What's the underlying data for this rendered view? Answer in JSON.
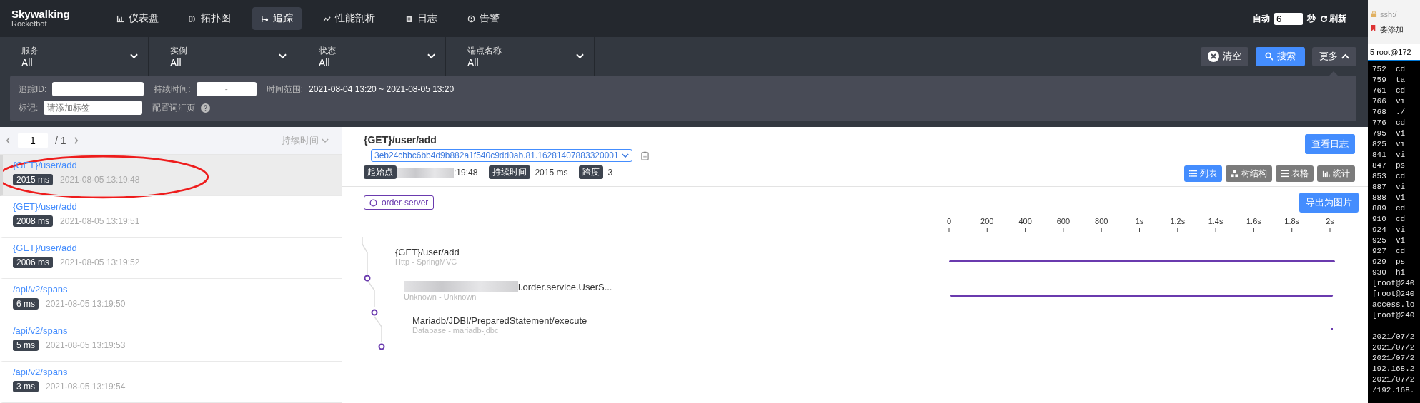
{
  "brand": {
    "name": "Skywalking",
    "sub": "Rocketbot"
  },
  "nav": [
    {
      "label": "仪表盘",
      "selected": false
    },
    {
      "label": "拓扑图",
      "selected": false
    },
    {
      "label": "追踪",
      "selected": true
    },
    {
      "label": "性能剖析",
      "selected": false
    },
    {
      "label": "日志",
      "selected": false
    },
    {
      "label": "告警",
      "selected": false
    }
  ],
  "refresh": {
    "auto_label": "自动",
    "interval": "6",
    "unit": "秒",
    "button": "刷新"
  },
  "filters": [
    {
      "label": "服务",
      "value": "All"
    },
    {
      "label": "实例",
      "value": "All"
    },
    {
      "label": "状态",
      "value": "All"
    },
    {
      "label": "端点名称",
      "value": "All"
    }
  ],
  "actions": {
    "clear": "清空",
    "search": "搜索",
    "more": "更多",
    "more_expanded": true
  },
  "advanced": {
    "trace_id_label": "追踪ID:",
    "duration_label": "持续时间:",
    "duration_sep": "-",
    "time_range_label": "时间范围:",
    "time_range": "2021-08-04 13:20 ~ 2021-08-05 13:20",
    "tags_label": "标记:",
    "tags_placeholder": "请添加标签",
    "vocab_link": "配置词汇页"
  },
  "pager": {
    "page": "1",
    "total": "/ 1",
    "sort": "持续时间"
  },
  "traces": [
    {
      "endpoint": "{GET}/user/add",
      "duration": "2015 ms",
      "time": "2021-08-05 13:19:48",
      "selected": true
    },
    {
      "endpoint": "{GET}/user/add",
      "duration": "2008 ms",
      "time": "2021-08-05 13:19:51",
      "selected": false
    },
    {
      "endpoint": "{GET}/user/add",
      "duration": "2006 ms",
      "time": "2021-08-05 13:19:52",
      "selected": false
    },
    {
      "endpoint": "/api/v2/spans",
      "duration": "6 ms",
      "time": "2021-08-05 13:19:50",
      "selected": false
    },
    {
      "endpoint": "/api/v2/spans",
      "duration": "5 ms",
      "time": "2021-08-05 13:19:53",
      "selected": false
    },
    {
      "endpoint": "/api/v2/spans",
      "duration": "3 ms",
      "time": "2021-08-05 13:19:54",
      "selected": false
    }
  ],
  "detail": {
    "title": "{GET}/user/add",
    "trace_id": "3eb24cbbc6bb4d9b882a1f540c9dd0ab.81.16281407883320001",
    "logs_button": "查看日志",
    "start_label": "起始点",
    "start_value": ":19:48",
    "duration_label": "持续时间",
    "duration_value": "2015 ms",
    "spans_label": "跨度",
    "spans_value": "3",
    "views": [
      {
        "label": "列表",
        "selected": true
      },
      {
        "label": "树结构",
        "selected": false
      },
      {
        "label": "表格",
        "selected": false
      },
      {
        "label": "统计",
        "selected": false
      }
    ],
    "service": "order-server",
    "export_button": "导出为图片",
    "spans": [
      {
        "name": "{GET}/user/add",
        "sub": "Http - SpringMVC",
        "blurred": false
      },
      {
        "name": "l.order.service.UserS...",
        "sub": "Unknown - Unknown",
        "blurred": true
      },
      {
        "name": "Mariadb/JDBI/PreparedStatement/execute",
        "sub": "Database - mariadb-jdbc",
        "blurred": false
      }
    ],
    "timeline_ticks": [
      "0",
      "200",
      "400",
      "600",
      "800",
      "1s",
      "1.2s",
      "1.4s",
      "1.6s",
      "1.8s",
      "2s"
    ]
  },
  "side_window": {
    "address": "ssh:/",
    "bookmark": "要添加",
    "tab": "5 root@172",
    "history": [
      "752  cd",
      "759  ta",
      "761  cd",
      "766  vi",
      "768  ./",
      "776  cd",
      "795  vi",
      "825  vi",
      "841  vi",
      "847  ps",
      "853  cd",
      "887  vi",
      "888  vi",
      "889  cd",
      "910  cd",
      "924  vi",
      "925  vi",
      "927  cd",
      "929  ps",
      "930  hi",
      "[root@240",
      "[root@240",
      "access.lo",
      "[root@240"
    ],
    "log": [
      "2021/07/2",
      "2021/07/2",
      "2021/07/2",
      "192.168.2",
      "2021/07/2",
      "/192.168."
    ]
  }
}
